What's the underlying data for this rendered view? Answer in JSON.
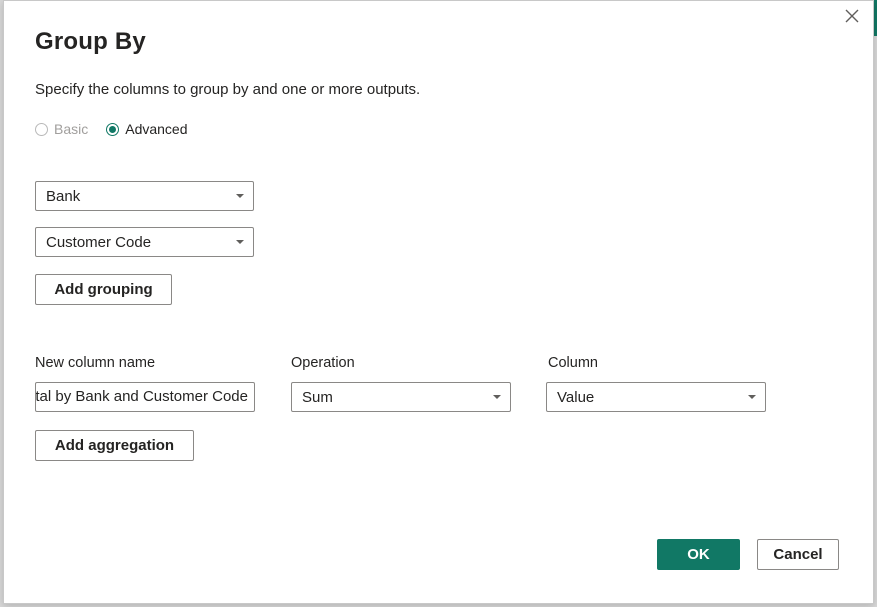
{
  "dialog": {
    "title": "Group By",
    "subtitle": "Specify the columns to group by and one or more outputs."
  },
  "mode": {
    "options": [
      {
        "label": "Basic",
        "selected": false,
        "disabled": true
      },
      {
        "label": "Advanced",
        "selected": true,
        "disabled": false
      }
    ]
  },
  "grouping": {
    "columns": [
      "Bank",
      "Customer Code"
    ],
    "add_label": "Add grouping"
  },
  "aggregation": {
    "headers": {
      "new_column_name": "New column name",
      "operation": "Operation",
      "column": "Column"
    },
    "rows": [
      {
        "new_column_name": "Total by Bank and Customer Code",
        "operation": "Sum",
        "column": "Value"
      }
    ],
    "add_label": "Add aggregation"
  },
  "footer": {
    "ok_label": "OK",
    "cancel_label": "Cancel"
  },
  "colors": {
    "accent": "#117865"
  }
}
